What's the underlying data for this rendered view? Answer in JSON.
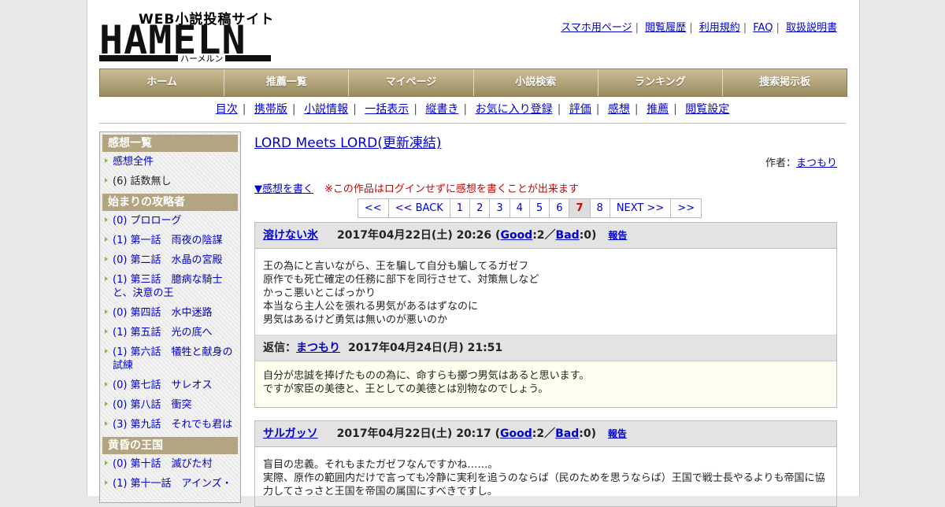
{
  "logo": {
    "sub": "WEB小説投稿サイト",
    "big": "HAMELN",
    "kana": "ハーメルン"
  },
  "toplinks": [
    "スマホ用ページ",
    "閲覧履歴",
    "利用規約",
    "FAQ",
    "取扱説明書"
  ],
  "mainnav": [
    "ホーム",
    "推薦一覧",
    "マイページ",
    "小説検索",
    "ランキング",
    "捜索掲示板"
  ],
  "subnav": [
    "目次",
    "携帯版",
    "小説情報",
    "一括表示",
    "縦書き",
    "お気に入り登録",
    "評価",
    "感想",
    "推薦",
    "閲覧設定"
  ],
  "sidebar": {
    "sections": [
      {
        "title": "感想一覧",
        "items": [
          {
            "label": "感想全件",
            "link": true
          },
          {
            "label": "(6) 話数無し",
            "link": false
          }
        ]
      },
      {
        "title": "始まりの攻略者",
        "items": [
          {
            "label": "(0) プロローグ",
            "link": true
          },
          {
            "label": "(1) 第一話　雨夜の陰謀",
            "link": true
          },
          {
            "label": "(0) 第二話　水晶の宮殿",
            "link": true
          },
          {
            "label": "(1) 第三話　臆病な騎士と、決意の王",
            "link": true
          },
          {
            "label": "(0) 第四話　水中迷路",
            "link": true
          },
          {
            "label": "(1) 第五話　光の底へ",
            "link": true
          },
          {
            "label": "(1) 第六話　犠牲と献身の試練",
            "link": true
          },
          {
            "label": "(0) 第七話　サレオス",
            "link": true
          },
          {
            "label": "(0) 第八話　衝突",
            "link": true
          },
          {
            "label": "(3) 第九話　それでも君は",
            "link": true
          }
        ]
      },
      {
        "title": "黄昏の王国",
        "items": [
          {
            "label": "(0) 第十話　滅びた村",
            "link": true
          },
          {
            "label": "(1) 第十一話　アインズ・",
            "link": true
          }
        ]
      }
    ]
  },
  "content": {
    "title": "LORD Meets LORD(更新凍結)",
    "author_label": "作者：",
    "author": "まつもり",
    "write_link": "▼感想を書く",
    "warning": "※この作品はログインせずに感想を書くことが出来ます",
    "pager": [
      "<<",
      "<< BACK",
      "1",
      "2",
      "3",
      "4",
      "5",
      "6",
      "7",
      "8",
      "NEXT >>",
      ">>"
    ],
    "current_page": "7",
    "comments": [
      {
        "user": "溶けない氷",
        "date": "2017年04月22日(土) 20:26",
        "good_label": "Good",
        "good": ":2／",
        "bad_label": "Bad",
        "bad": ":0)",
        "report": "報告",
        "body": "王の為にと言いながら、王を騙して自分も騙してるガゼフ\n原作でも死亡確定の任務に部下を同行させて、対策無しなど\nかっこ悪いとこばっかり\n本当なら主人公を張れる男気があるはずなのに\n男気はあるけど勇気は無いのが悪いのか",
        "reply_label": "返信：",
        "reply_user": "まつもり",
        "reply_date": "2017年04月24日(月) 21:51",
        "reply_body": "自分が忠誠を捧げたものの為に、命すらも擲つ男気はあると思います。\nですが家臣の美徳と、王としての美徳とは別物なのでしょう。"
      },
      {
        "user": "サルガッソ",
        "date": "2017年04月22日(土) 20:17",
        "good_label": "Good",
        "good": ":2／",
        "bad_label": "Bad",
        "bad": ":0)",
        "report": "報告",
        "body": "盲目の忠義。それもまたガゼフなんですかね……。\n実際、原作の範囲内だけで言っても冷静に実利を追うのならば（民のためを思うならば）王国で戦士長やるよりも帝国に協力してさっさと王国を帝国の属国にすべきですし。"
      }
    ]
  }
}
